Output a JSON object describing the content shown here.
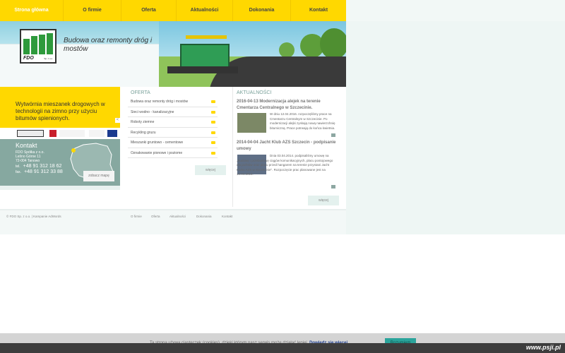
{
  "nav": {
    "items": [
      {
        "label": "Strona główna"
      },
      {
        "label": "O firmie"
      },
      {
        "label": "Oferta"
      },
      {
        "label": "Aktualności"
      },
      {
        "label": "Dokonania"
      },
      {
        "label": "Kontakt"
      }
    ]
  },
  "header": {
    "logo_text": "FDO",
    "logo_sub": "Sp. z o.o.",
    "slogan": "Budowa oraz remonty dróg i mostów"
  },
  "promo": {
    "text": "Wytwórnia mieszanek drogowych w technologii na zimno przy użyciu bitumów spienionych.",
    "arrow": "<"
  },
  "contact": {
    "title": "Kontakt",
    "company": "FDO Spółka z o.o.",
    "street": "Lešno Górne 11",
    "city": "72-004 Tanowo",
    "tel_label": "tel.",
    "tel": "+48 91 312 18 62",
    "fax_label": "fax.",
    "fax": "+48 91 312 33 88",
    "map_button": "zobacz mapę"
  },
  "offer": {
    "title": "OFERTA",
    "items": [
      {
        "label": "Budowa oraz remonty dróg i mostów"
      },
      {
        "label": "Sieci wodno - kanalizacyjne"
      },
      {
        "label": "Roboty ziemne"
      },
      {
        "label": "Recykling gruzu"
      },
      {
        "label": "Mieszanki gruntowo - cementowe"
      },
      {
        "label": "Oznakowanie pionowe i poziome"
      }
    ],
    "more": "więcej"
  },
  "news": {
    "title": "AKTUALNOŚCI",
    "items": [
      {
        "title": "2016-04-13 Modernizacja alejek na terenie Cmentarza Centralnego w Szczecinie.",
        "text": "W dniu 12.04.2016. rozpoczęliśmy prace na Cmentarzu Centralnym w Szczecinie. Po modernizacji alejki zyskają nową nawierzchnię bitumiczną. Prace potrwają do końca kwietnia."
      },
      {
        "title": "2014-04-04 Jacht Klub AZS Szczecin - podpisanie umowy",
        "text": "Dnia 03.04.2014. podpisaliśmy umowę na „Budowę i przebudowę ciągów komunikacyjnych, placu postojowego dla jachtów oraz placu przed hangarem na terenie przystani Jacht Klubu AZS w Szczecinie\". Rozpoczęcie prac planowane jest na 14.04.2014."
      }
    ],
    "more": "więcej"
  },
  "footer": {
    "copyright": "© FDO Sp. z o.o. | Kampanie AdWords",
    "links": [
      {
        "label": "O firmie"
      },
      {
        "label": "Oferta"
      },
      {
        "label": "Aktualności"
      },
      {
        "label": "Dokonania"
      },
      {
        "label": "Kontakt"
      }
    ]
  },
  "cookie": {
    "message": "Ta strona używa ciasteczek (cookies), dzięki którym nasz serwis może działać lepiej.",
    "link": "Dowiedz się więcej",
    "button": "Rozumiem"
  },
  "watermark": "www.psji.pl",
  "colors": {
    "accent_yellow": "#ffd800",
    "contact_bg": "#86a8a0",
    "cookie_button": "#2aa49b"
  }
}
